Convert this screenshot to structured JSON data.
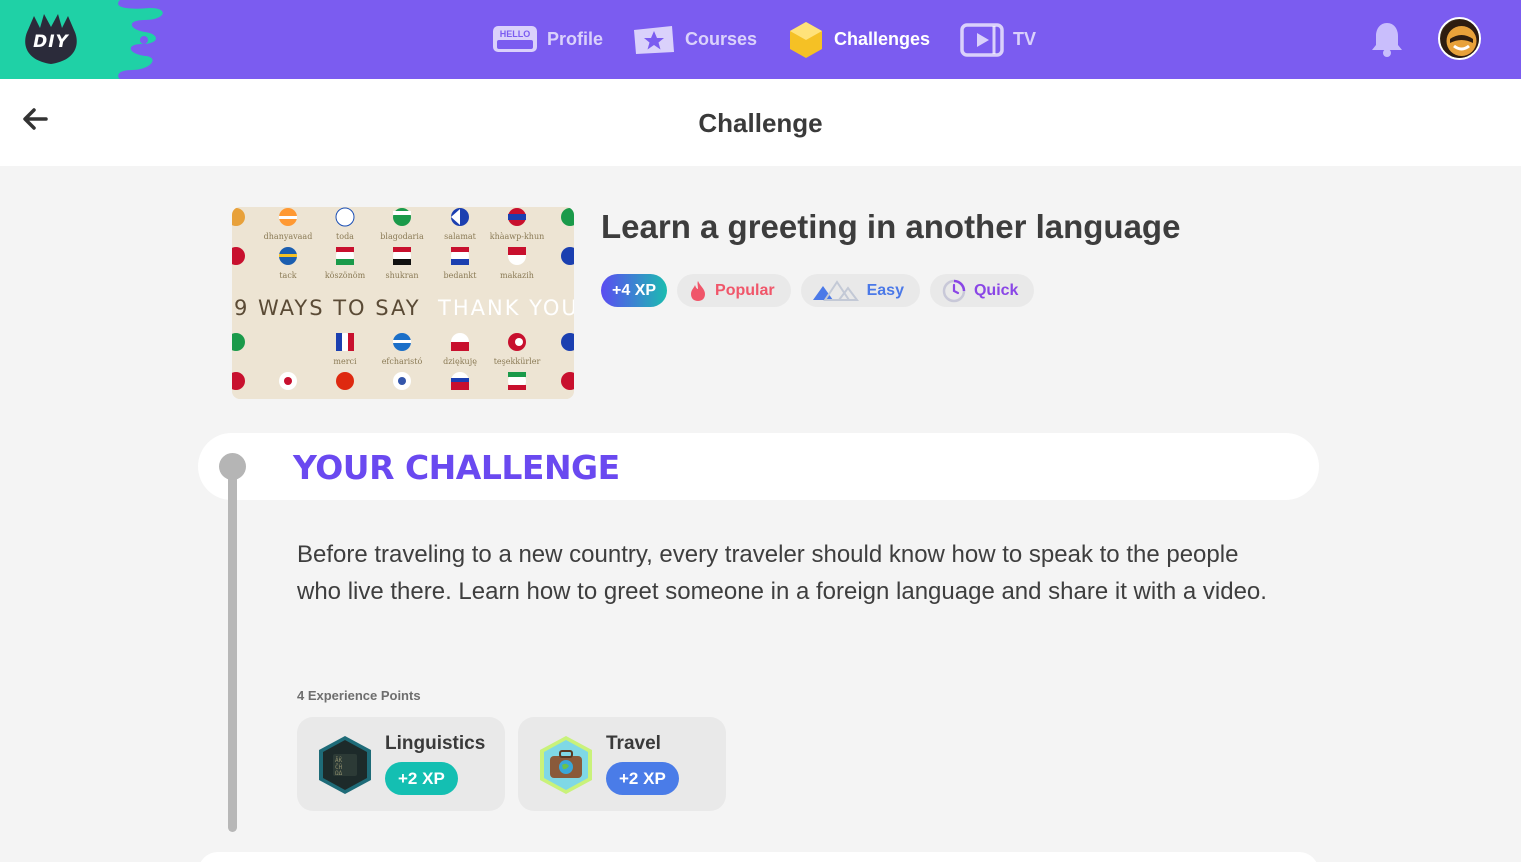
{
  "nav": {
    "logo": "DIY",
    "profile_badge": "HELLO",
    "items": [
      {
        "label": "Profile",
        "icon": "hello-badge-icon"
      },
      {
        "label": "Courses",
        "icon": "star-card-icon"
      },
      {
        "label": "Challenges",
        "icon": "hexagon-icon",
        "active": true
      },
      {
        "label": "TV",
        "icon": "play-screen-icon"
      }
    ]
  },
  "header": {
    "title": "Challenge"
  },
  "challenge": {
    "title": "Learn a greeting in another language",
    "thumbnail": {
      "headline_left": "9 WAYS TO SAY",
      "headline_right": "THANK YOU",
      "words_row1": [
        "dhanyavaad",
        "toda",
        "blagodaria",
        "salamat",
        "khàawp-khun"
      ],
      "words_row2": [
        "tack",
        "köszönöm",
        "shukran",
        "bedankt",
        "makazih"
      ],
      "words_row3": [
        "merci",
        "efcharistó",
        "dziękuję",
        "teşekkürler"
      ]
    },
    "tags": {
      "xp": "+4 XP",
      "popular": "Popular",
      "easy": "Easy",
      "quick": "Quick"
    }
  },
  "your_challenge": {
    "heading": "YOUR CHALLENGE",
    "description": "Before traveling to a new country, every traveler should know how to speak to the people who live there. Learn how to greet someone in a foreign language and share it with a video.",
    "xp_label": "4 Experience Points",
    "skills": [
      {
        "name": "Linguistics",
        "xp": "+2 XP",
        "icon": "linguistics-skill-icon"
      },
      {
        "name": "Travel",
        "xp": "+2 XP",
        "icon": "travel-skill-icon"
      }
    ]
  },
  "colors": {
    "nav_bg": "#7b5cf0",
    "logo_green": "#1fd1a6",
    "accent_purple": "#6a49f0",
    "teal": "#14bfb2",
    "blue": "#4a7ce8"
  }
}
